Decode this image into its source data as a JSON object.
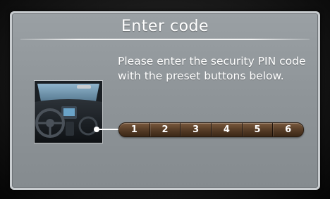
{
  "dialog": {
    "title": "Enter code",
    "message": "Please enter the security PIN code with the preset buttons below."
  },
  "preset_buttons": [
    "1",
    "2",
    "3",
    "4",
    "5",
    "6"
  ],
  "colors": {
    "screen_bg": "#8f9599",
    "text": "#ffffff",
    "preset_bar": "#5a3f29"
  }
}
